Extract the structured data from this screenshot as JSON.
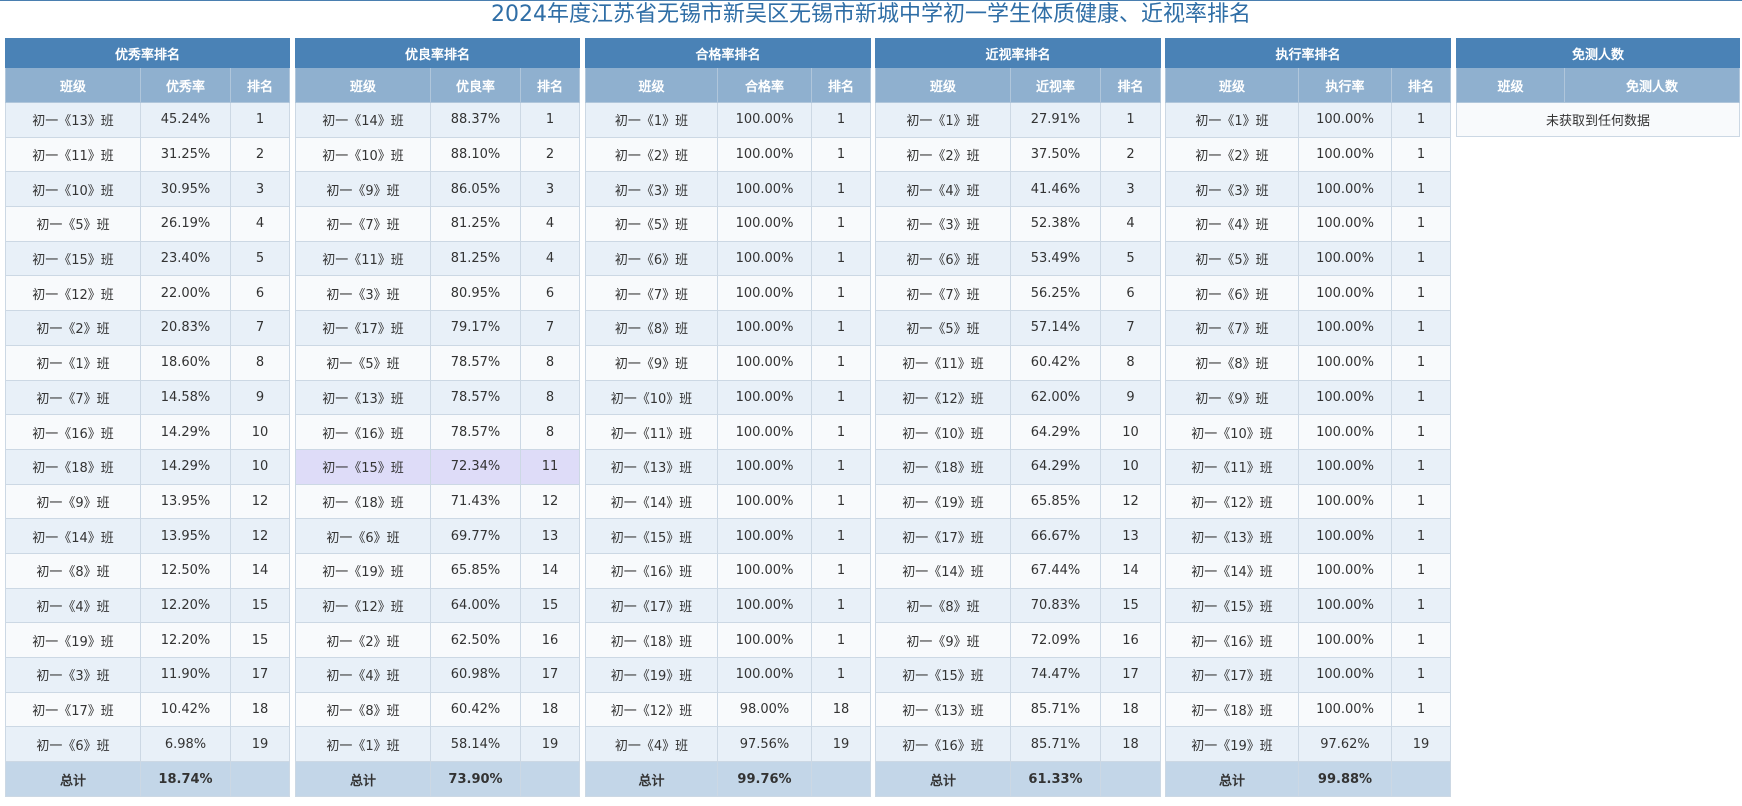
{
  "title": "2024年度江苏省无锡市新吴区无锡市新城中学初一学生体质健康、近视率排名",
  "tables": [
    {
      "key": "excellent",
      "title": "优秀率排名",
      "cols": [
        "班级",
        "优秀率",
        "排名"
      ],
      "rows": [
        [
          "初一《13》班",
          "45.24%",
          "1"
        ],
        [
          "初一《11》班",
          "31.25%",
          "2"
        ],
        [
          "初一《10》班",
          "30.95%",
          "3"
        ],
        [
          "初一《5》班",
          "26.19%",
          "4"
        ],
        [
          "初一《15》班",
          "23.40%",
          "5"
        ],
        [
          "初一《12》班",
          "22.00%",
          "6"
        ],
        [
          "初一《2》班",
          "20.83%",
          "7"
        ],
        [
          "初一《1》班",
          "18.60%",
          "8"
        ],
        [
          "初一《7》班",
          "14.58%",
          "9"
        ],
        [
          "初一《16》班",
          "14.29%",
          "10"
        ],
        [
          "初一《18》班",
          "14.29%",
          "10"
        ],
        [
          "初一《9》班",
          "13.95%",
          "12"
        ],
        [
          "初一《14》班",
          "13.95%",
          "12"
        ],
        [
          "初一《8》班",
          "12.50%",
          "14"
        ],
        [
          "初一《4》班",
          "12.20%",
          "15"
        ],
        [
          "初一《19》班",
          "12.20%",
          "15"
        ],
        [
          "初一《3》班",
          "11.90%",
          "17"
        ],
        [
          "初一《17》班",
          "10.42%",
          "18"
        ],
        [
          "初一《6》班",
          "6.98%",
          "19"
        ]
      ],
      "total": [
        "总计",
        "18.74%",
        ""
      ]
    },
    {
      "key": "good",
      "title": "优良率排名",
      "cols": [
        "班级",
        "优良率",
        "排名"
      ],
      "rows": [
        [
          "初一《14》班",
          "88.37%",
          "1"
        ],
        [
          "初一《10》班",
          "88.10%",
          "2"
        ],
        [
          "初一《9》班",
          "86.05%",
          "3"
        ],
        [
          "初一《7》班",
          "81.25%",
          "4"
        ],
        [
          "初一《11》班",
          "81.25%",
          "4"
        ],
        [
          "初一《3》班",
          "80.95%",
          "6"
        ],
        [
          "初一《17》班",
          "79.17%",
          "7"
        ],
        [
          "初一《5》班",
          "78.57%",
          "8"
        ],
        [
          "初一《13》班",
          "78.57%",
          "8"
        ],
        [
          "初一《16》班",
          "78.57%",
          "8"
        ],
        [
          "初一《15》班",
          "72.34%",
          "11"
        ],
        [
          "初一《18》班",
          "71.43%",
          "12"
        ],
        [
          "初一《6》班",
          "69.77%",
          "13"
        ],
        [
          "初一《19》班",
          "65.85%",
          "14"
        ],
        [
          "初一《12》班",
          "64.00%",
          "15"
        ],
        [
          "初一《2》班",
          "62.50%",
          "16"
        ],
        [
          "初一《4》班",
          "60.98%",
          "17"
        ],
        [
          "初一《8》班",
          "60.42%",
          "18"
        ],
        [
          "初一《1》班",
          "58.14%",
          "19"
        ]
      ],
      "total": [
        "总计",
        "73.90%",
        ""
      ],
      "highlight_row": 10
    },
    {
      "key": "pass",
      "title": "合格率排名",
      "cols": [
        "班级",
        "合格率",
        "排名"
      ],
      "rows": [
        [
          "初一《1》班",
          "100.00%",
          "1"
        ],
        [
          "初一《2》班",
          "100.00%",
          "1"
        ],
        [
          "初一《3》班",
          "100.00%",
          "1"
        ],
        [
          "初一《5》班",
          "100.00%",
          "1"
        ],
        [
          "初一《6》班",
          "100.00%",
          "1"
        ],
        [
          "初一《7》班",
          "100.00%",
          "1"
        ],
        [
          "初一《8》班",
          "100.00%",
          "1"
        ],
        [
          "初一《9》班",
          "100.00%",
          "1"
        ],
        [
          "初一《10》班",
          "100.00%",
          "1"
        ],
        [
          "初一《11》班",
          "100.00%",
          "1"
        ],
        [
          "初一《13》班",
          "100.00%",
          "1"
        ],
        [
          "初一《14》班",
          "100.00%",
          "1"
        ],
        [
          "初一《15》班",
          "100.00%",
          "1"
        ],
        [
          "初一《16》班",
          "100.00%",
          "1"
        ],
        [
          "初一《17》班",
          "100.00%",
          "1"
        ],
        [
          "初一《18》班",
          "100.00%",
          "1"
        ],
        [
          "初一《19》班",
          "100.00%",
          "1"
        ],
        [
          "初一《12》班",
          "98.00%",
          "18"
        ],
        [
          "初一《4》班",
          "97.56%",
          "19"
        ]
      ],
      "total": [
        "总计",
        "99.76%",
        ""
      ]
    },
    {
      "key": "myopia",
      "title": "近视率排名",
      "cols": [
        "班级",
        "近视率",
        "排名"
      ],
      "rows": [
        [
          "初一《1》班",
          "27.91%",
          "1"
        ],
        [
          "初一《2》班",
          "37.50%",
          "2"
        ],
        [
          "初一《4》班",
          "41.46%",
          "3"
        ],
        [
          "初一《3》班",
          "52.38%",
          "4"
        ],
        [
          "初一《6》班",
          "53.49%",
          "5"
        ],
        [
          "初一《7》班",
          "56.25%",
          "6"
        ],
        [
          "初一《5》班",
          "57.14%",
          "7"
        ],
        [
          "初一《11》班",
          "60.42%",
          "8"
        ],
        [
          "初一《12》班",
          "62.00%",
          "9"
        ],
        [
          "初一《10》班",
          "64.29%",
          "10"
        ],
        [
          "初一《18》班",
          "64.29%",
          "10"
        ],
        [
          "初一《19》班",
          "65.85%",
          "12"
        ],
        [
          "初一《17》班",
          "66.67%",
          "13"
        ],
        [
          "初一《14》班",
          "67.44%",
          "14"
        ],
        [
          "初一《8》班",
          "70.83%",
          "15"
        ],
        [
          "初一《9》班",
          "72.09%",
          "16"
        ],
        [
          "初一《15》班",
          "74.47%",
          "17"
        ],
        [
          "初一《13》班",
          "85.71%",
          "18"
        ],
        [
          "初一《16》班",
          "85.71%",
          "18"
        ]
      ],
      "total": [
        "总计",
        "61.33%",
        ""
      ]
    },
    {
      "key": "execution",
      "title": "执行率排名",
      "cols": [
        "班级",
        "执行率",
        "排名"
      ],
      "rows": [
        [
          "初一《1》班",
          "100.00%",
          "1"
        ],
        [
          "初一《2》班",
          "100.00%",
          "1"
        ],
        [
          "初一《3》班",
          "100.00%",
          "1"
        ],
        [
          "初一《4》班",
          "100.00%",
          "1"
        ],
        [
          "初一《5》班",
          "100.00%",
          "1"
        ],
        [
          "初一《6》班",
          "100.00%",
          "1"
        ],
        [
          "初一《7》班",
          "100.00%",
          "1"
        ],
        [
          "初一《8》班",
          "100.00%",
          "1"
        ],
        [
          "初一《9》班",
          "100.00%",
          "1"
        ],
        [
          "初一《10》班",
          "100.00%",
          "1"
        ],
        [
          "初一《11》班",
          "100.00%",
          "1"
        ],
        [
          "初一《12》班",
          "100.00%",
          "1"
        ],
        [
          "初一《13》班",
          "100.00%",
          "1"
        ],
        [
          "初一《14》班",
          "100.00%",
          "1"
        ],
        [
          "初一《15》班",
          "100.00%",
          "1"
        ],
        [
          "初一《16》班",
          "100.00%",
          "1"
        ],
        [
          "初一《17》班",
          "100.00%",
          "1"
        ],
        [
          "初一《18》班",
          "100.00%",
          "1"
        ],
        [
          "初一《19》班",
          "97.62%",
          "19"
        ]
      ],
      "total": [
        "总计",
        "99.88%",
        ""
      ]
    }
  ],
  "exempt": {
    "title": "免测人数",
    "cols": [
      "班级",
      "免测人数"
    ],
    "empty_text": "未获取到任何数据"
  }
}
